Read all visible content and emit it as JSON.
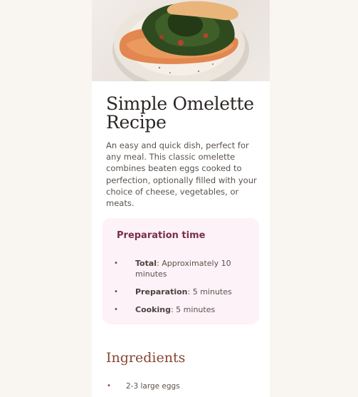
{
  "hero": {
    "image": "omelette-photo"
  },
  "recipe": {
    "title": "Simple Omelette Recipe",
    "intro": "An easy and quick dish, perfect for any meal. This classic omelette combines beaten eggs cooked to perfection, optionally filled with your choice of cheese, vegetables, or meats."
  },
  "preparation": {
    "heading": "Preparation time",
    "items": [
      {
        "label": "Total",
        "text": ": Approximately 10 minutes"
      },
      {
        "label": "Preparation",
        "text": ": 5 minutes"
      },
      {
        "label": "Cooking",
        "text": ": 5 minutes"
      }
    ]
  },
  "ingredients": {
    "heading": "Ingredients",
    "items": [
      "2-3 large eggs"
    ]
  },
  "colors": {
    "page_background": "#f9f6f2",
    "card_background": "#ffffff",
    "prep_background": "#fdf2f7",
    "prep_accent": "#7a2e4d",
    "ingredients_accent": "#854632",
    "heading_text": "#2a2624",
    "body_text": "#5a524d"
  },
  "icons": {
    "bullet": "•"
  }
}
